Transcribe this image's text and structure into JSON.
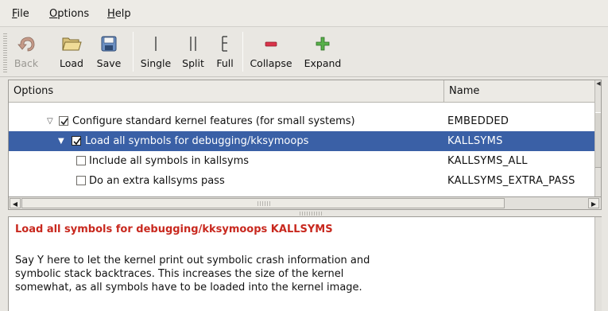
{
  "menu": {
    "file": {
      "mnemonic": "F",
      "rest": "ile"
    },
    "options": {
      "mnemonic": "O",
      "rest": "ptions"
    },
    "help": {
      "mnemonic": "H",
      "rest": "elp"
    }
  },
  "toolbar": {
    "back": "Back",
    "load": "Load",
    "save": "Save",
    "single": "Single",
    "split": "Split",
    "full": "Full",
    "collapse": "Collapse",
    "expand": "Expand"
  },
  "tree": {
    "headers": {
      "options": "Options",
      "name": "Name"
    },
    "rows": [
      {
        "label": "Configure standard kernel features (for small systems)",
        "name": "EMBEDDED",
        "checked": true,
        "expanded": true,
        "selected": false
      },
      {
        "label": "Load all symbols for debugging/kksymoops",
        "name": "KALLSYMS",
        "checked": true,
        "expanded": true,
        "selected": true
      },
      {
        "label": "Include all symbols in kallsyms",
        "name": "KALLSYMS_ALL",
        "checked": false,
        "selected": false
      },
      {
        "label": "Do an extra kallsyms pass",
        "name": "KALLSYMS_EXTRA_PASS",
        "checked": false,
        "selected": false
      }
    ]
  },
  "help": {
    "title": "Load all symbols for debugging/kksymoops KALLSYMS",
    "lines": [
      "Say Y here to let the kernel print out symbolic crash information and",
      "symbolic stack backtraces. This increases the size of the kernel",
      "somewhat, as all symbols have to be loaded into the kernel image."
    ]
  },
  "colors": {
    "selection": "#3a60a6",
    "help_title": "#c8281e"
  }
}
